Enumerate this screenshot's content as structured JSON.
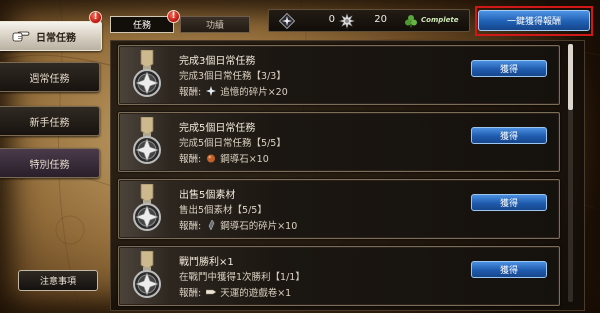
{
  "sidebar": {
    "items": [
      {
        "label": "日常任務",
        "badge": "!",
        "selected": true,
        "icon": "pointer-hand-icon"
      },
      {
        "label": "週常任務"
      },
      {
        "label": "新手任務"
      },
      {
        "label": "特別任務"
      }
    ],
    "notice_label": "注意事項"
  },
  "tabs": [
    {
      "label": "任務",
      "badge": "!",
      "selected": true
    },
    {
      "label": "功績"
    }
  ],
  "currency": [
    {
      "icon": "crystal-diamond-icon",
      "value": "0"
    },
    {
      "icon": "starburst-icon",
      "value": "20"
    },
    {
      "icon": "clover-icon",
      "value": "Complete"
    }
  ],
  "claim_all_label": "一鍵獲得報酬",
  "quest_reward_label": "報酬:",
  "quest_claim_label": "獲得",
  "quests": [
    {
      "title": "完成3個日常任務",
      "desc": "完成3個日常任務【3/3】",
      "reward_icon": "memory-shard-icon",
      "reward": "追憶的碎片×20"
    },
    {
      "title": "完成5個日常任務",
      "desc": "完成5個日常任務【5/5】",
      "reward_icon": "guide-stone-icon",
      "reward": "鋼導石×10"
    },
    {
      "title": "出售5個素材",
      "desc": "售出5個素材【5/5】",
      "reward_icon": "stone-shard-icon",
      "reward": "鋼導石的碎片×10"
    },
    {
      "title": "戰鬥勝利×1",
      "desc": "在戰鬥中獲得1次勝利【1/1】",
      "reward_icon": "ticket-icon",
      "reward": "天運的遊戲卷×1"
    }
  ],
  "colors": {
    "accent_blue": "#2060b4",
    "badge_red": "#b8140e",
    "highlight_red": "#d01818",
    "parchment": "#9c743e"
  }
}
